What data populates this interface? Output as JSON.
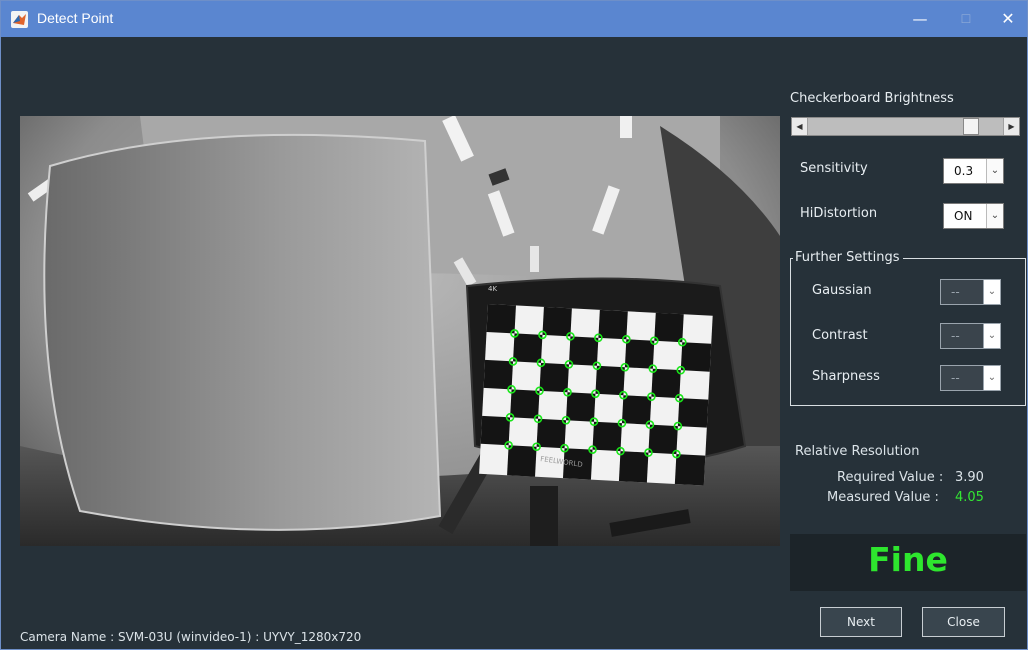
{
  "window": {
    "title": "Detect Point",
    "min_glyph": "—",
    "max_glyph": "☐",
    "close_glyph": "✕"
  },
  "brightness": {
    "label": "Checkerboard Brightness",
    "level": 0.86
  },
  "sensitivity": {
    "label": "Sensitivity",
    "value": "0.3"
  },
  "hidistortion": {
    "label": "HiDistortion",
    "value": "ON"
  },
  "further": {
    "title": "Further Settings",
    "gaussian": {
      "label": "Gaussian",
      "value": "--"
    },
    "contrast": {
      "label": "Contrast",
      "value": "--"
    },
    "sharpness": {
      "label": "Sharpness",
      "value": "--"
    }
  },
  "resolution": {
    "title": "Relative Resolution",
    "required_label": "Required Value :",
    "required_value": "3.90",
    "measured_label": "Measured Value :",
    "measured_value": "4.05",
    "measured_color": "#33e633"
  },
  "status": {
    "text": "Fine",
    "color": "#2ee62e"
  },
  "buttons": {
    "next": "Next",
    "close": "Close"
  },
  "footer": {
    "camera": "Camera Name : SVM-03U (winvideo-1) : UYVY_1280x720"
  },
  "image": {
    "monitor_label": "4K",
    "brand": "FEELWORLD"
  }
}
